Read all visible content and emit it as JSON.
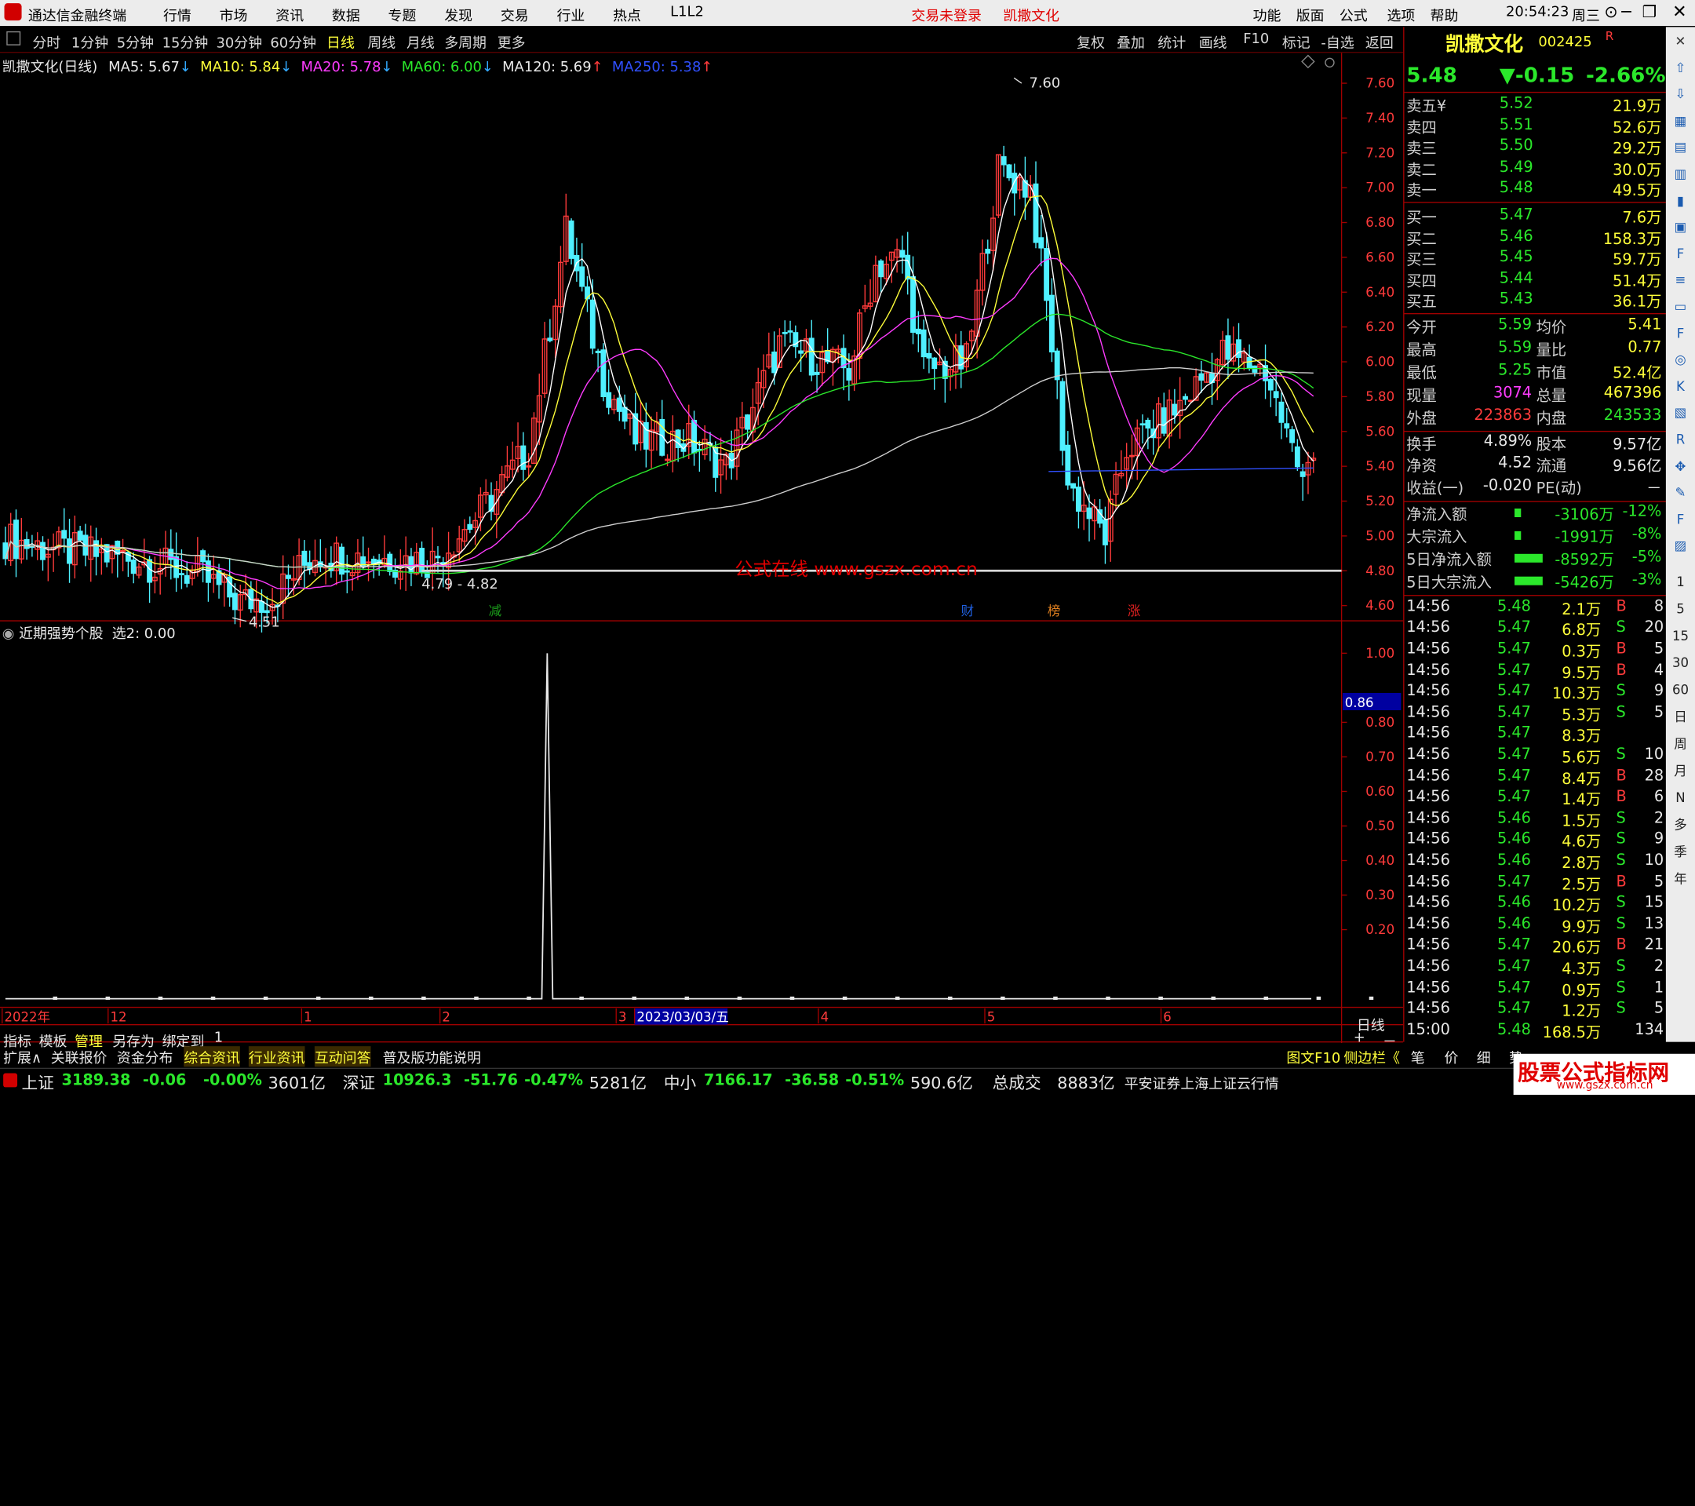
{
  "titlebar": {
    "app": "通达信金融终端",
    "menus": [
      "行情",
      "市场",
      "资讯",
      "数据",
      "专题",
      "发现",
      "交易",
      "行业",
      "热点",
      "L1L2"
    ],
    "login": "交易未登录",
    "stock": "凯撒文化",
    "right_menus": [
      "功能",
      "版面",
      "公式",
      "选项",
      "帮助"
    ],
    "time": "20:54:23",
    "weekday": "周三"
  },
  "toolbar": {
    "periods": [
      "分时",
      "1分钟",
      "5分钟",
      "15分钟",
      "30分钟",
      "60分钟",
      "日线",
      "周线",
      "月线",
      "多周期",
      "更多"
    ],
    "active": "日线",
    "right": [
      "复权",
      "叠加",
      "统计",
      "画线",
      "F10",
      "标记",
      "-自选",
      "返回"
    ]
  },
  "chart_header": {
    "name": "凯撒文化(日线)",
    "ma5": "MA5: 5.67",
    "ma10": "MA10: 5.84",
    "ma20": "MA20: 5.78",
    "ma60": "MA60: 6.00",
    "ma120": "MA120: 5.69",
    "ma250": "MA250: 5.38"
  },
  "indicator_header": {
    "name": "近期强势个股",
    "value": "选2: 0.00"
  },
  "chart_data": [
    {
      "type": "candlestick",
      "title": "凯撒文化(日线)",
      "ylim": [
        4.5,
        7.65
      ],
      "yticks": [
        "7.60",
        "7.40",
        "7.20",
        "7.00",
        "6.80",
        "6.60",
        "6.40",
        "6.20",
        "6.00",
        "5.80",
        "5.60",
        "5.40",
        "5.20",
        "5.00",
        "4.80",
        "4.60"
      ],
      "annotations": [
        "7.60",
        "4.79 - 4.82",
        "4.51"
      ],
      "support_line": 4.8,
      "events": [
        "减",
        "财",
        "榜",
        "涨"
      ],
      "x_labels": [
        "2022年",
        "12",
        "1",
        "2",
        "3",
        "2023/03/03/五",
        "4",
        "5",
        "6"
      ],
      "last_close": 5.48
    },
    {
      "type": "line",
      "title": "近期强势个股",
      "ylim": [
        0,
        1.05
      ],
      "yticks": [
        "1.00",
        "0.80",
        "0.70",
        "0.60",
        "0.50",
        "0.40",
        "0.30",
        "0.20"
      ],
      "cursor": "0.86",
      "values": [
        0,
        0,
        0,
        0,
        0,
        0,
        0,
        0,
        0,
        0,
        0,
        0,
        0,
        0,
        0,
        0,
        0,
        0,
        0,
        0,
        0,
        0,
        0,
        0,
        0,
        0,
        0,
        0,
        0,
        0,
        0,
        0,
        0,
        0,
        0,
        0,
        0,
        0,
        0,
        0,
        0,
        0,
        0,
        0,
        0,
        0,
        0,
        0,
        0,
        0,
        0,
        0,
        0,
        0,
        0,
        0,
        0,
        0,
        0,
        0,
        0,
        0,
        0,
        0,
        0,
        0,
        0,
        0,
        0,
        0,
        0,
        0,
        0,
        0,
        0,
        0,
        0,
        0,
        0,
        0,
        0,
        0,
        0,
        0,
        0,
        0,
        0,
        0,
        0,
        0,
        0,
        0,
        0,
        0,
        0,
        0,
        0,
        0,
        0,
        0,
        1,
        0,
        0,
        0,
        0,
        0,
        0,
        0,
        0,
        0,
        0,
        0,
        0,
        0,
        0,
        0,
        0,
        0,
        0,
        0,
        0,
        0,
        0,
        0,
        0,
        0,
        0,
        0,
        0,
        0,
        0,
        0,
        0,
        0,
        0,
        0,
        0,
        0,
        0,
        0,
        0,
        0,
        0,
        0,
        0,
        0,
        0,
        0,
        0,
        0,
        0,
        0,
        0,
        0,
        0,
        0,
        0,
        0,
        0,
        0,
        0,
        0,
        0,
        0,
        0,
        0,
        0,
        0,
        0,
        0,
        0,
        0,
        0,
        0,
        0,
        0,
        0,
        0,
        0,
        0,
        0,
        0,
        0,
        0,
        0,
        0,
        0,
        0,
        0,
        0,
        0,
        0,
        0,
        0,
        0,
        0,
        0,
        0,
        0,
        0,
        0,
        0,
        0,
        0,
        0,
        0,
        0,
        0,
        0,
        0,
        0,
        0,
        0,
        0,
        0,
        0,
        0,
        0,
        0,
        0,
        0,
        0,
        0,
        0,
        0,
        0,
        0,
        0,
        0,
        0,
        0,
        0,
        0,
        0,
        0,
        0,
        0,
        0,
        0,
        0,
        0,
        0
      ]
    }
  ],
  "watermark": "公式在线 www.gszx.com.cn",
  "quote": {
    "name": "凯撒文化",
    "code": "002425",
    "price": "5.48",
    "change": "▼-0.15",
    "pct": "-2.66%",
    "asks": [
      {
        "l": "卖五¥",
        "p": "5.52",
        "v": "21.9万"
      },
      {
        "l": "卖四",
        "p": "5.51",
        "v": "52.6万"
      },
      {
        "l": "卖三",
        "p": "5.50",
        "v": "29.2万"
      },
      {
        "l": "卖二",
        "p": "5.49",
        "v": "30.0万"
      },
      {
        "l": "卖一",
        "p": "5.48",
        "v": "49.5万"
      }
    ],
    "bids": [
      {
        "l": "买一",
        "p": "5.47",
        "v": "7.6万"
      },
      {
        "l": "买二",
        "p": "5.46",
        "v": "158.3万"
      },
      {
        "l": "买三",
        "p": "5.45",
        "v": "59.7万"
      },
      {
        "l": "买四",
        "p": "5.44",
        "v": "51.4万"
      },
      {
        "l": "买五",
        "p": "5.43",
        "v": "36.1万"
      }
    ],
    "stats": [
      [
        "今开",
        "5.59",
        "均价",
        "5.41"
      ],
      [
        "最高",
        "5.59",
        "量比",
        "0.77"
      ],
      [
        "最低",
        "5.25",
        "市值",
        "52.4亿"
      ],
      [
        "现量",
        "3074",
        "总量",
        "467396"
      ],
      [
        "外盘",
        "223863",
        "内盘",
        "243533"
      ],
      [
        "换手",
        "4.89%",
        "股本",
        "9.57亿"
      ],
      [
        "净资",
        "4.52",
        "流通",
        "9.56亿"
      ],
      [
        "收益(一)",
        "-0.020",
        "PE(动)",
        "－"
      ]
    ],
    "flows": [
      [
        "净流入额",
        "-3106万",
        "-12%"
      ],
      [
        "大宗流入",
        "-1991万",
        "-8%"
      ],
      [
        "5日净流入额",
        "-8592万",
        "-5%"
      ],
      [
        "5日大宗流入",
        "-5426万",
        "-3%"
      ]
    ]
  },
  "ticks": [
    [
      "14:56",
      "5.48",
      "2.1万",
      "B",
      "8"
    ],
    [
      "14:56",
      "5.47",
      "6.8万",
      "S",
      "20"
    ],
    [
      "14:56",
      "5.47",
      "0.3万",
      "B",
      "5"
    ],
    [
      "14:56",
      "5.47",
      "9.5万",
      "B",
      "4"
    ],
    [
      "14:56",
      "5.47",
      "10.3万",
      "S",
      "9"
    ],
    [
      "14:56",
      "5.47",
      "5.3万",
      "S",
      "5"
    ],
    [
      "14:56",
      "5.47",
      "8.3万",
      "",
      ""
    ],
    [
      "14:56",
      "5.47",
      "5.6万",
      "S",
      "10"
    ],
    [
      "14:56",
      "5.47",
      "8.4万",
      "B",
      "28"
    ],
    [
      "14:56",
      "5.47",
      "1.4万",
      "B",
      "6"
    ],
    [
      "14:56",
      "5.46",
      "1.5万",
      "S",
      "2"
    ],
    [
      "14:56",
      "5.46",
      "4.6万",
      "S",
      "9"
    ],
    [
      "14:56",
      "5.46",
      "2.8万",
      "S",
      "10"
    ],
    [
      "14:56",
      "5.47",
      "2.5万",
      "B",
      "5"
    ],
    [
      "14:56",
      "5.46",
      "10.2万",
      "S",
      "15"
    ],
    [
      "14:56",
      "5.46",
      "9.9万",
      "S",
      "13"
    ],
    [
      "14:56",
      "5.47",
      "20.6万",
      "B",
      "21"
    ],
    [
      "14:56",
      "5.47",
      "4.3万",
      "S",
      "2"
    ],
    [
      "14:56",
      "5.47",
      "0.9万",
      "S",
      "1"
    ],
    [
      "14:56",
      "5.47",
      "1.2万",
      "S",
      "5"
    ],
    [
      "15:00",
      "5.48",
      "168.5万",
      "",
      "134"
    ]
  ],
  "sidebar_icons": [
    "close-icon",
    "arrow-up-icon",
    "arrow-down-icon",
    "grid-icon",
    "list-icon",
    "chart-icon",
    "candle-icon",
    "table-icon",
    "f10-icon",
    "news-icon",
    "doc-icon",
    "f2-icon",
    "globe-icon",
    "k-icon",
    "chart2-icon",
    "rsi-icon",
    "move-icon",
    "pen-icon",
    "fs-icon",
    "kline-icon"
  ],
  "sidebar_labels": [
    "1",
    "5",
    "15",
    "30",
    "60",
    "日",
    "周",
    "月",
    "N",
    "多",
    "季",
    "年"
  ],
  "bottom": {
    "tabs": [
      "指标",
      "模板",
      "管理",
      "另存为",
      "绑定到",
      "1"
    ],
    "tabs2": [
      "扩展∧",
      "关联报价",
      "资金分布",
      "综合资讯",
      "行业资讯",
      "互动问答",
      "普及版功能说明"
    ],
    "right": [
      "日线",
      "+",
      "－"
    ],
    "right2": [
      "图文F10",
      "侧边栏《",
      "笔",
      "价",
      "细",
      "势"
    ]
  },
  "status": {
    "items": [
      [
        "上证",
        "3189.38",
        "-0.06",
        "-0.00%",
        "3601亿"
      ],
      [
        "深证",
        "10926.3",
        "-51.76",
        "-0.47%",
        "5281亿"
      ],
      [
        "中小",
        "7166.17",
        "-36.58",
        "-0.51%",
        "590.6亿"
      ]
    ],
    "total_label": "总成交",
    "total": "8883亿",
    "broker": "平安证券上海上证云行情",
    "logo": "股票公式指标网",
    "logo_url": "www.gszx.com.cn"
  }
}
